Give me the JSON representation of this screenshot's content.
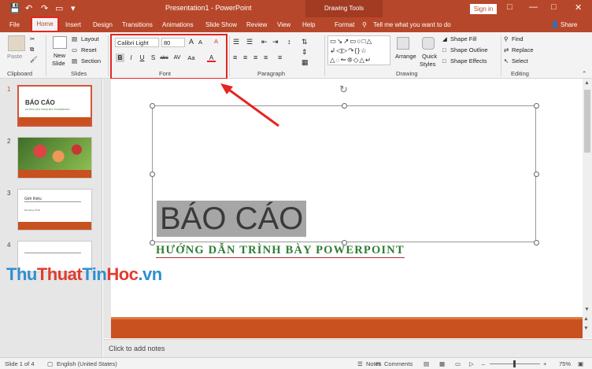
{
  "titlebar": {
    "title": "Presentation1 - PowerPoint",
    "context_label": "Drawing Tools",
    "sign_in": "Sign in"
  },
  "tabs": [
    "File",
    "Home",
    "Insert",
    "Design",
    "Transitions",
    "Animations",
    "Slide Show",
    "Review",
    "View",
    "Help",
    "Format"
  ],
  "tell_me": "Tell me what you want to do",
  "share": "Share",
  "ribbon": {
    "clipboard": {
      "label": "Clipboard",
      "paste": "Paste"
    },
    "slides": {
      "label": "Slides",
      "new_slide": "New",
      "new_slide2": "Slide",
      "layout": "Layout",
      "reset": "Reset",
      "section": "Section"
    },
    "font": {
      "label": "Font",
      "font_name": "Calibri Light",
      "font_size": "80",
      "grow": "A",
      "shrink": "A",
      "clear": "A",
      "bold": "B",
      "italic": "I",
      "underline": "U",
      "shadow": "S",
      "strike": "abc",
      "spacing": "AV",
      "case": "Aa",
      "color": "A"
    },
    "paragraph": {
      "label": "Paragraph"
    },
    "drawing": {
      "label": "Drawing",
      "arrange": "Arrange",
      "quick_styles": "Quick",
      "quick_styles2": "Styles",
      "shape_fill": "Shape Fill",
      "shape_outline": "Shape Outline",
      "shape_effects": "Shape Effects"
    },
    "editing": {
      "label": "Editing",
      "find": "Find",
      "replace": "Replace",
      "select": "Select"
    }
  },
  "thumbnails": [
    {
      "num": "1",
      "title": "BÁO CÁO",
      "sub": "HƯỚNG DẪN TRÌNH BÀY POWERPOINT"
    },
    {
      "num": "2"
    },
    {
      "num": "3",
      "title": "Giới thiệu",
      "sub": "Nội dung chính"
    },
    {
      "num": "4"
    }
  ],
  "slide": {
    "title": "BÁO CÁO",
    "subtitle": "HƯỚNG DẪN TRÌNH BÀY POWERPOINT"
  },
  "watermark": {
    "part1": "Thu",
    "part2": "Thuat",
    "part3": "Tin",
    "part4": "Hoc",
    "part5": ".vn"
  },
  "notes_placeholder": "Click to add notes",
  "status": {
    "slide_count": "Slide 1 of 4",
    "language": "English (United States)",
    "notes": "Notes",
    "comments": "Comments",
    "zoom": "75%"
  },
  "colors": {
    "accent": "#b7472a",
    "highlight": "#e52521",
    "slide_bar": "#c9501f"
  }
}
